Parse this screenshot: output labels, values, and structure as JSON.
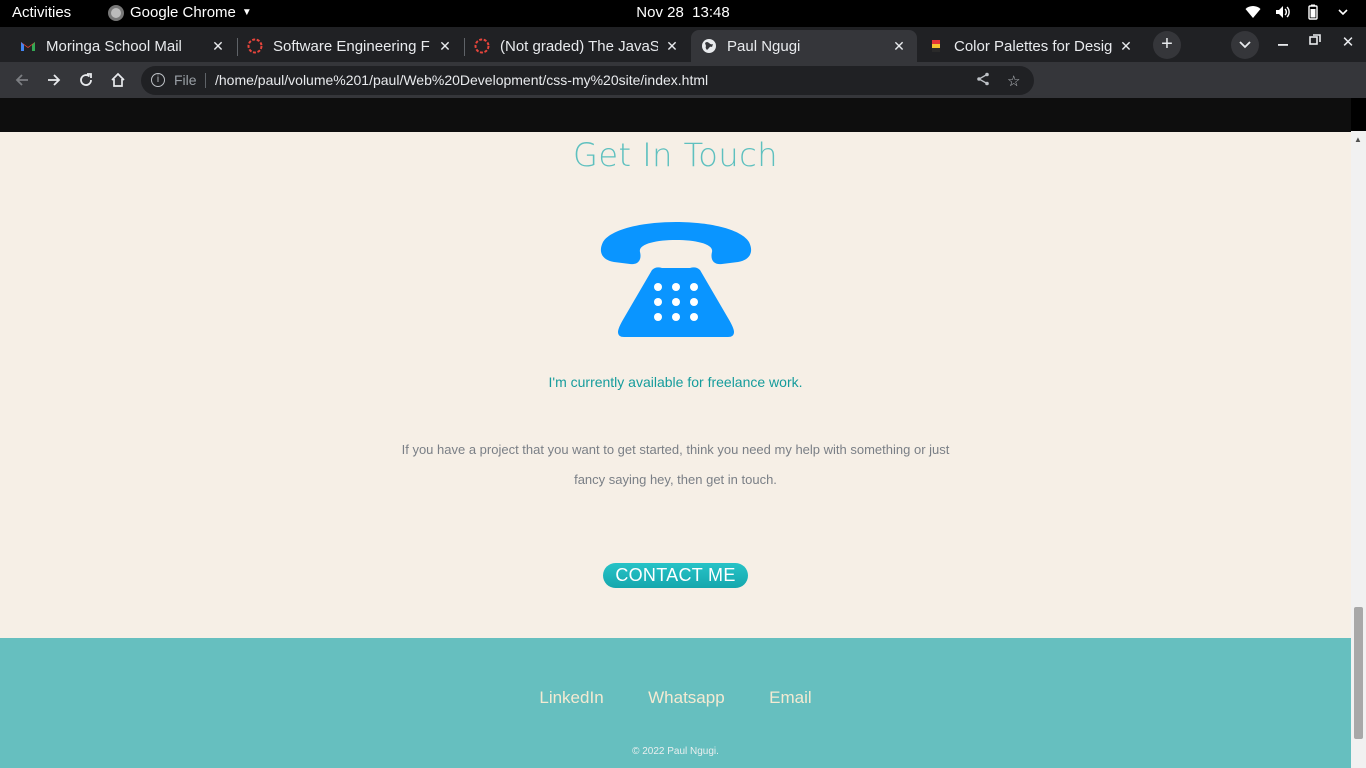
{
  "os_bar": {
    "activities": "Activities",
    "app_name": "Google Chrome",
    "date": "Nov 28",
    "time": "13:48"
  },
  "tabs": [
    {
      "title": "Moringa School Mail",
      "favicon": "gmail-icon",
      "active": false
    },
    {
      "title": "Software Engineering F",
      "favicon": "moringa-icon",
      "active": false
    },
    {
      "title": "(Not graded) The JavaSc",
      "favicon": "moringa-icon",
      "active": false
    },
    {
      "title": "Paul Ngugi",
      "favicon": "globe-icon",
      "active": true
    },
    {
      "title": "Color Palettes for Desig",
      "favicon": "colorhunt-icon",
      "active": false
    }
  ],
  "omnibox": {
    "scheme_label": "File",
    "url": "/home/paul/volume%201/paul/Web%20Development/css-my%20site/index.html"
  },
  "page": {
    "contact_title": "Get In Touch",
    "phone_icon": "telephone-icon",
    "freelance_text": "I'm currently available for freelance work.",
    "blurb_line1": "If you have a project that you want to get started, think you need my help with something or just",
    "blurb_line2": "fancy saying hey, then get in touch.",
    "contact_button": "CONTACT ME",
    "footer_links": [
      "LinkedIn",
      "Whatsapp",
      "Email"
    ],
    "copyright": "© 2022 Paul Ngugi."
  },
  "colors": {
    "page_bg": "#f6efe6",
    "accent_teal": "#5ec0bf",
    "phone_blue": "#0a95ff",
    "footer_bg": "#66bfbf",
    "footer_link": "#f4ead2"
  }
}
